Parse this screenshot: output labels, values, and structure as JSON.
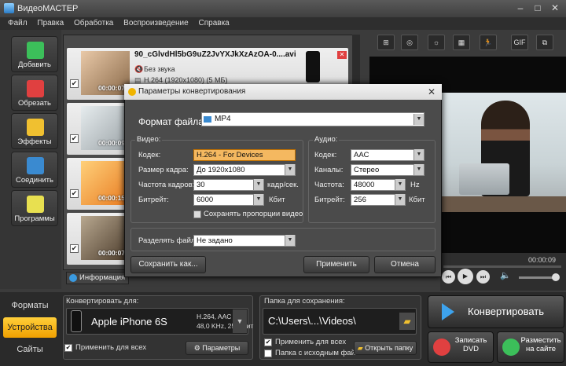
{
  "window": {
    "title": "ВидеоМАСТЕР",
    "min": "–",
    "max": "□",
    "close": "✕"
  },
  "menu": [
    "Файл",
    "Правка",
    "Обработка",
    "Воспроизведение",
    "Справка"
  ],
  "sidebar": [
    {
      "label": "Добавить",
      "icon": "add-file-icon",
      "color": "#3cbf5a"
    },
    {
      "label": "Обрезать",
      "icon": "scissors-icon",
      "color": "#e04040"
    },
    {
      "label": "Эффекты",
      "icon": "effects-icon",
      "color": "#f0c030"
    },
    {
      "label": "Соединить",
      "icon": "join-icon",
      "color": "#3a8ad0"
    },
    {
      "label": "Программы",
      "icon": "programs-icon",
      "color": "#e8e050"
    }
  ],
  "files": [
    {
      "name": "90_cGlvdHl5bG9uZ2JvYXJkXzAzOA-0....avi",
      "audio": "Без звука",
      "video": "H.264 (1920x1080) (5 МБ)",
      "duration": "00:00:07",
      "checked": "✔"
    },
    {
      "duration": "00:00:09",
      "checked": "✔"
    },
    {
      "duration": "00:00:15",
      "checked": "✔"
    },
    {
      "duration": "00:00:07",
      "checked": "✔"
    }
  ],
  "info_tab": "Информация",
  "toolbar": [
    "⊞",
    "◎",
    "☼",
    "▦",
    "🏃",
    "GIF",
    "⧉"
  ],
  "player": {
    "time": "00:00:09",
    "prev": "⏮",
    "play": "▶",
    "next": "⏭",
    "volume_icon": "🔈",
    "volume": 0.85
  },
  "dialog": {
    "title": "Параметры конвертирования",
    "close": "✕",
    "format_label": "Формат файла:",
    "format_value": "MP4",
    "video_group": "Видео:",
    "audio_group": "Аудио:",
    "video": {
      "codec_label": "Кодек:",
      "codec": "H.264 - For Devices",
      "size_label": "Размер кадра:",
      "size": "До 1920x1080",
      "fps_label": "Частота кадров:",
      "fps": "30",
      "fps_unit": "кадр/сек.",
      "bitrate_label": "Битрейт:",
      "bitrate": "6000",
      "bitrate_unit": "Кбит",
      "keep_ratio": "Сохранять пропорции видео"
    },
    "audio": {
      "codec_label": "Кодек:",
      "codec": "AAC",
      "channels_label": "Каналы:",
      "channels": "Стерео",
      "rate_label": "Частота:",
      "rate": "48000",
      "rate_unit": "Hz",
      "bitrate_label": "Битрейт:",
      "bitrate": "256",
      "bitrate_unit": "Кбит"
    },
    "split_label": "Разделять файл:",
    "split_value": "Не задано",
    "save_as": "Сохранить как...",
    "apply": "Применить",
    "cancel": "Отмена"
  },
  "bottom": {
    "tabs": [
      "Форматы",
      "Устройства",
      "Сайты"
    ],
    "convert_for_label": "Конвертировать для:",
    "device": "Apple iPhone 6S",
    "spec1": "H.264, AAC",
    "spec2": "48,0 KHz, 256Кбит",
    "apply_all": "Применить для всех",
    "params": "⚙ Параметры",
    "save_folder_label": "Папка для сохранения:",
    "path": "C:\\Users\\...\\Videos\\",
    "apply_all2": "Применить для всех",
    "source_folder": "Папка с исходным файлом",
    "open_folder": "Открыть папку",
    "convert": "Конвертировать",
    "burn_dvd": "Записать DVD",
    "publish": "Разместить на сайте",
    "check": "✔"
  }
}
